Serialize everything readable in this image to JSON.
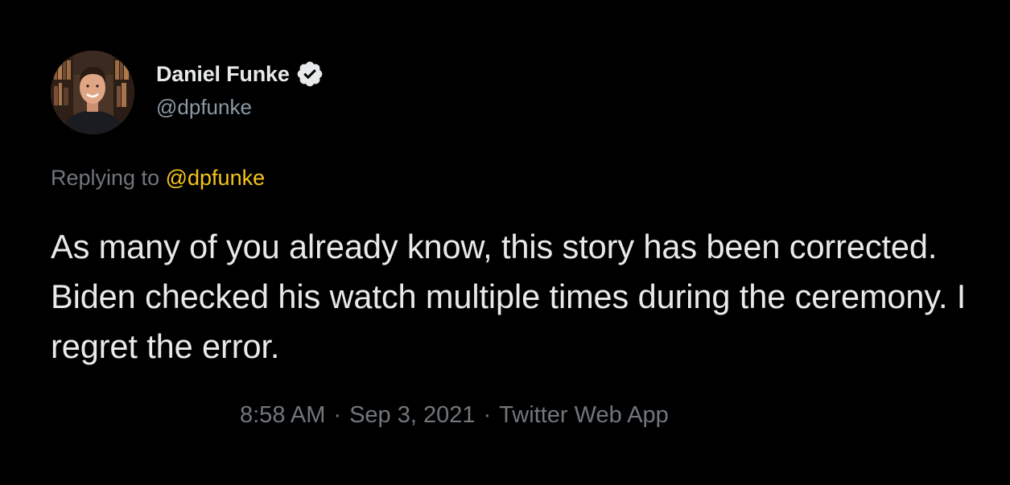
{
  "author": {
    "display_name": "Daniel Funke",
    "handle": "@dpfunke",
    "verified_icon": "verified-badge-icon"
  },
  "reply": {
    "prefix": "Replying to",
    "handle": "@dpfunke"
  },
  "tweet": {
    "text": "As many of you already know, this story has been corrected. Biden checked his watch multiple times during the ceremony. I regret the error."
  },
  "meta": {
    "time": "8:58 AM",
    "separator": "·",
    "date": "Sep 3, 2021",
    "source": "Twitter Web App"
  },
  "colors": {
    "background": "#000000",
    "text": "#e7e9ea",
    "secondary_text": "#71767b",
    "reply_link": "#f5c518"
  }
}
